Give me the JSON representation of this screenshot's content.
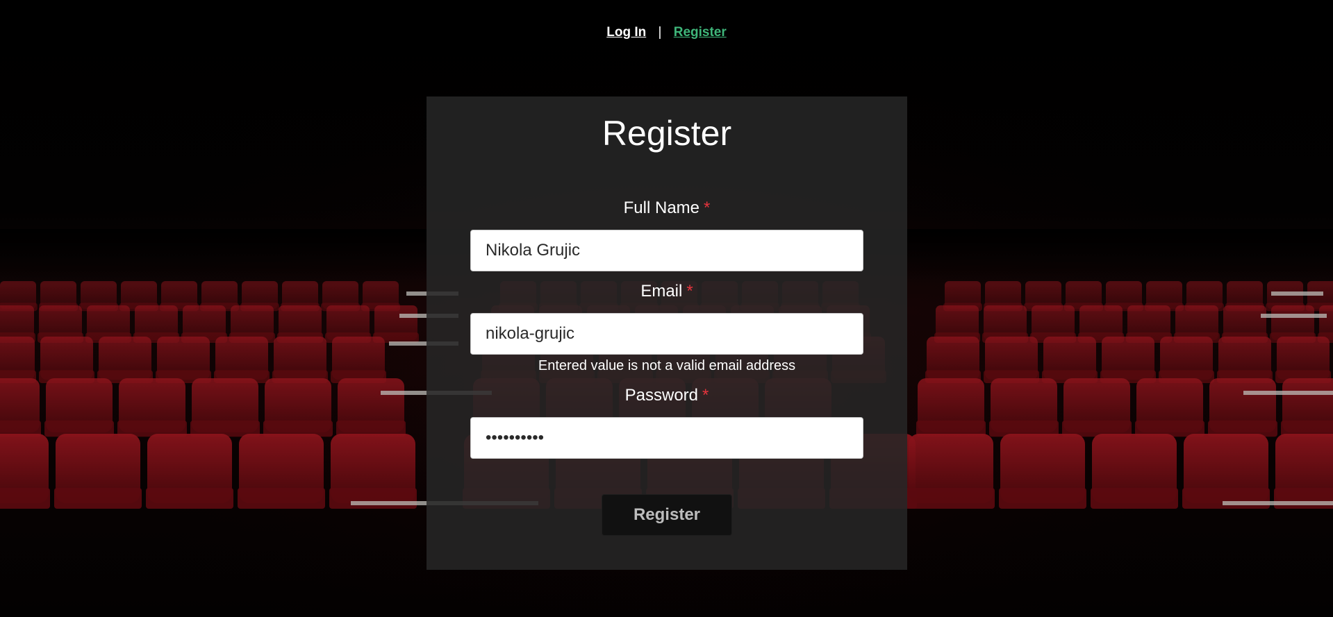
{
  "nav": {
    "login_label": "Log In",
    "separator": "|",
    "register_label": "Register"
  },
  "form": {
    "title": "Register",
    "required_marker": "*",
    "full_name": {
      "label": "Full Name",
      "value": "Nikola Grujic"
    },
    "email": {
      "label": "Email",
      "value": "nikola-grujic",
      "error": "Entered value is not a valid email address"
    },
    "password": {
      "label": "Password",
      "value": "••••••••••"
    },
    "submit_label": "Register"
  },
  "colors": {
    "accent_link": "#3fb67a",
    "required": "#e5343d",
    "card_background": "#262626",
    "seat_red": "#7a0f16"
  }
}
